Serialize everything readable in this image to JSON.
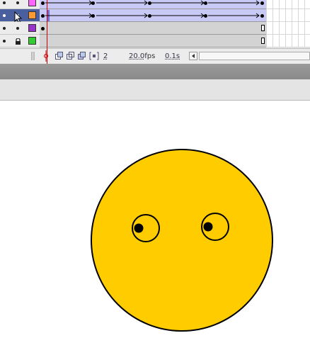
{
  "timeline": {
    "layers": [
      {
        "selected": false,
        "lock": "dot",
        "color": "#ff66ff",
        "frames": "tween"
      },
      {
        "selected": true,
        "lock": "dot",
        "color": "#ff9933",
        "frames": "tween"
      },
      {
        "selected": false,
        "lock": "dot",
        "color": "#9933cc",
        "frames": "empty"
      },
      {
        "selected": false,
        "lock": "lock-icon",
        "color": "#33cc33",
        "frames": "empty"
      }
    ]
  },
  "status_bar": {
    "current_frame": "2",
    "frame_rate": "20.0",
    "frame_rate_unit": "fps",
    "elapsed_time": "0.1s"
  },
  "stage": {
    "face_color": "#ffcc00",
    "outline_color": "#000000"
  }
}
